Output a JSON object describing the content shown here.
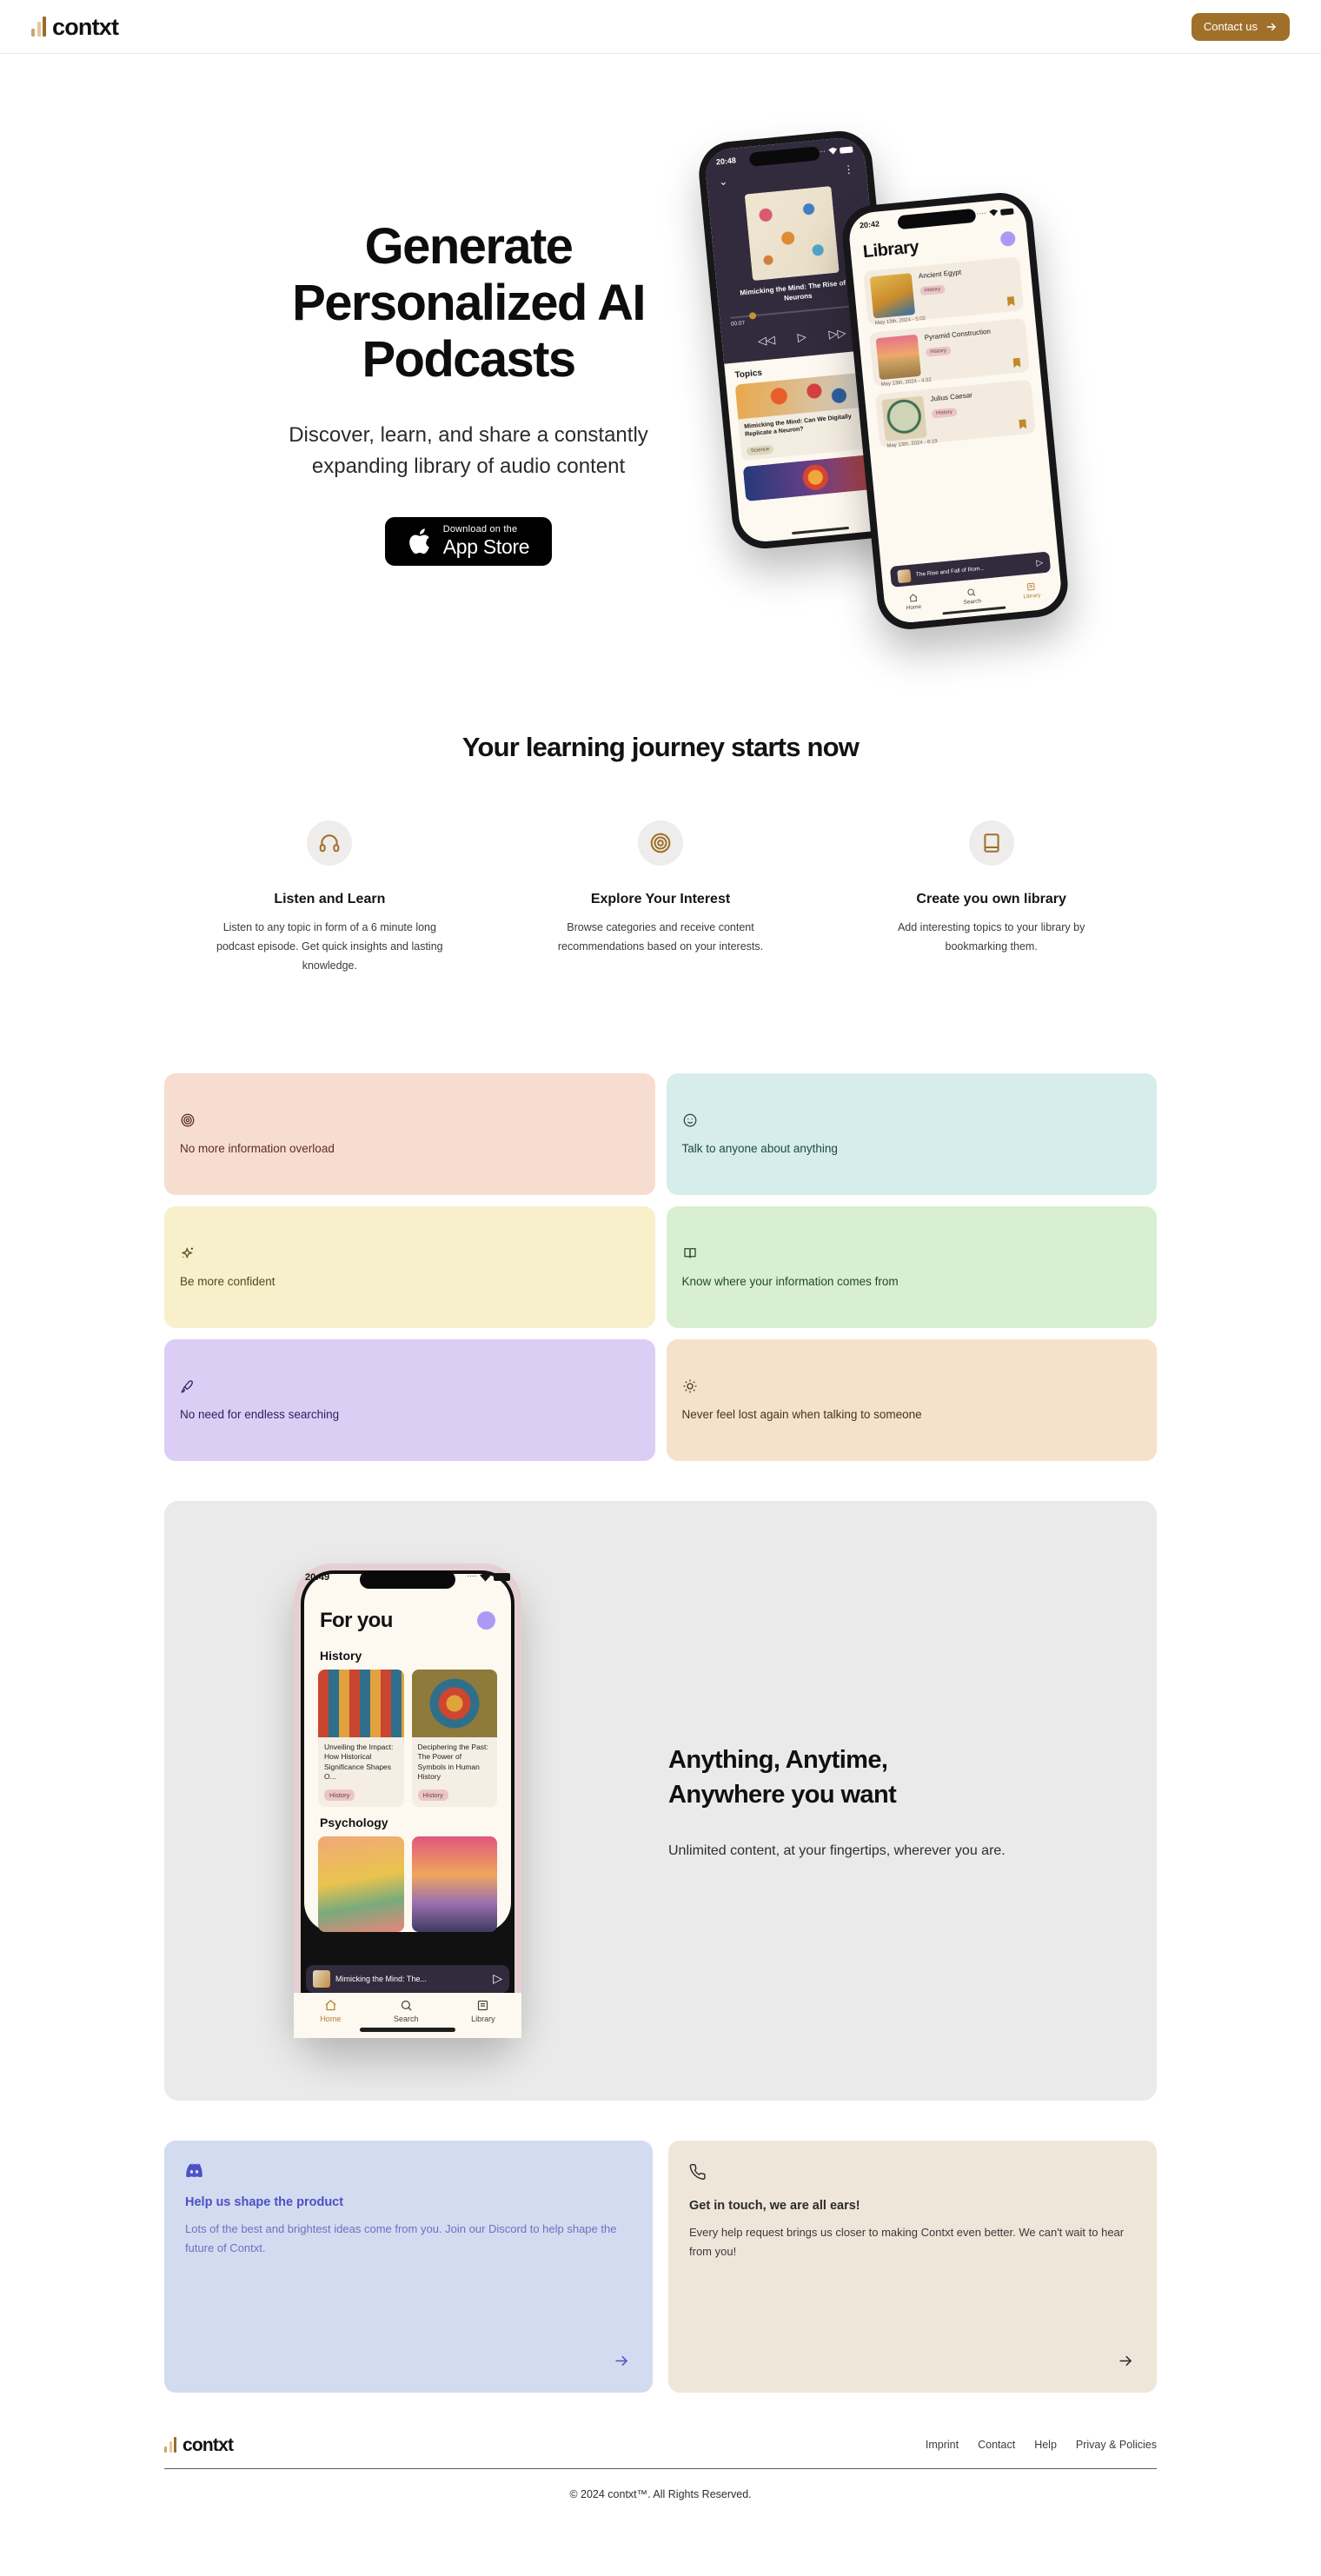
{
  "brand": {
    "name": "contxt",
    "accent": "#a0702a"
  },
  "nav": {
    "contact_label": "Contact us"
  },
  "hero": {
    "title_line1": "Generate",
    "title_line2": "Personalized AI",
    "title_line3": "Podcasts",
    "subtitle": "Discover, learn, and share a constantly expanding library of audio content",
    "appstore_small": "Download on the",
    "appstore_big": "App Store"
  },
  "hero_phone_player": {
    "time": "20:48",
    "episode_title": "Mimicking the Mind: The Rise of AI Neurons",
    "elapsed": "00:07",
    "topics_heading": "Topics",
    "topics": [
      {
        "title": "Mimicking the Mind: Can We Digitally Replicate a Neuron?",
        "tag": "Science"
      }
    ]
  },
  "hero_phone_library": {
    "time": "20:42",
    "title": "Library",
    "items": [
      {
        "name": "Ancient Egypt",
        "tag": "History",
        "date": "May 13th, 2024 - 5:02"
      },
      {
        "name": "Pyramid Construction",
        "tag": "History",
        "date": "May 13th, 2024 - 4:32"
      },
      {
        "name": "Julius Caesar",
        "tag": "History",
        "date": "May 13th, 2024 - 6:19"
      }
    ],
    "now_playing": "The Rise and Fall of Rom...",
    "tabs": [
      "Home",
      "Search",
      "Library"
    ],
    "active_tab": "Library"
  },
  "journey": {
    "heading": "Your learning journey starts now",
    "columns": [
      {
        "icon": "headphones-icon",
        "title": "Listen and Learn",
        "body": "Listen to any topic in form of a 6 minute long podcast episode. Get quick insights and lasting knowledge."
      },
      {
        "icon": "target-icon",
        "title": "Explore Your Interest",
        "body": "Browse categories and receive content recommendations based on your interests."
      },
      {
        "icon": "book-icon",
        "title": "Create you own library",
        "body": "Add interesting topics to your library by bookmarking them."
      }
    ]
  },
  "feature_cards": [
    {
      "label": "No more information overload",
      "icon": "target-icon",
      "bg": "#f7ddd0",
      "fg": "#5b2f20"
    },
    {
      "label": "Talk to anyone about anything",
      "icon": "smiley-icon",
      "bg": "#d6edeb",
      "fg": "#1e4a48"
    },
    {
      "label": "Be more confident",
      "icon": "sparkle-icon",
      "bg": "#f7f0cb",
      "fg": "#4f4a1c"
    },
    {
      "label": "Know where your information comes from",
      "icon": "open-book-icon",
      "bg": "#d8efd2",
      "fg": "#254a26"
    },
    {
      "label": "No need for endless searching",
      "icon": "rocket-icon",
      "bg": "#dccdf5",
      "fg": "#2f1d5c"
    },
    {
      "label": "Never feel lost again when talking to someone",
      "icon": "sun-icon",
      "bg": "#f6e2cb",
      "fg": "#4a3320"
    }
  ],
  "showcase": {
    "title_line1": "Anything, Anytime,",
    "title_line2": "Anywhere you want",
    "body": "Unlimited content, at your fingertips, wherever you are."
  },
  "showcase_phone": {
    "time": "20:49",
    "title": "For you",
    "sections": [
      {
        "name": "History",
        "cards": [
          {
            "title": "Unveiling the Impact: How Historical Significance Shapes O...",
            "tag": "History"
          },
          {
            "title": "Deciphering the Past: The Power of Symbols in Human History",
            "tag": "History"
          }
        ]
      },
      {
        "name": "Psychology",
        "cards": []
      }
    ],
    "now_playing": "Mimicking the Mind: The...",
    "tabs": [
      "Home",
      "Search",
      "Library"
    ],
    "active_tab": "Home"
  },
  "cta": [
    {
      "icon": "discord-icon",
      "title": "Help us shape the product",
      "body": "Lots of the best and brightest ideas come from you. Join our Discord to help shape the future of Contxt."
    },
    {
      "icon": "phone-icon",
      "title": "Get in touch, we are all ears!",
      "body": "Every help request brings us closer to making Contxt even better. We can't wait to hear from you!"
    }
  ],
  "footer": {
    "links": [
      "Imprint",
      "Contact",
      "Help",
      "Privay & Policies"
    ],
    "copyright": "© 2024 contxt™. All Rights Reserved."
  }
}
